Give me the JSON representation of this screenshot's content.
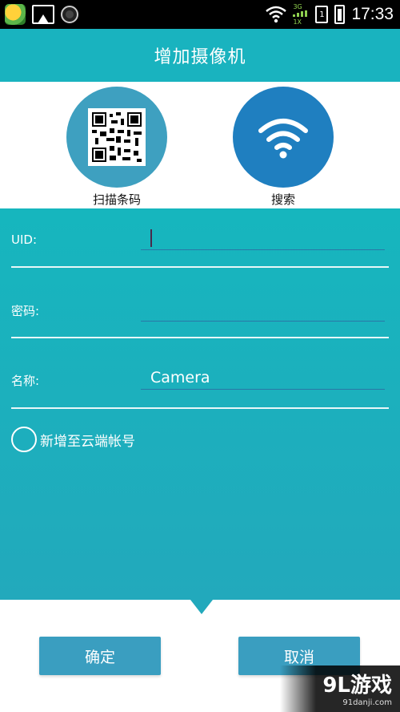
{
  "status_bar": {
    "time": "17:33",
    "signal_top": "3G",
    "signal_bottom": "1X",
    "sim": "1",
    "icons": [
      "game-app-icon",
      "gallery-icon",
      "camera-app-icon",
      "wifi-icon",
      "signal-icon",
      "sim-icon",
      "battery-icon"
    ]
  },
  "header": {
    "title": "增加摄像机"
  },
  "actions": {
    "scan": {
      "label": "扫描条码",
      "icon": "qr-code-icon"
    },
    "search": {
      "label": "搜索",
      "icon": "wifi-icon"
    }
  },
  "form": {
    "uid": {
      "label": "UID:",
      "value": ""
    },
    "password": {
      "label": "密码:",
      "value": ""
    },
    "name": {
      "label": "名称:",
      "value": "Camera"
    },
    "cloud_account": {
      "label": "新增至云端帐号",
      "checked": false
    }
  },
  "buttons": {
    "ok": "确定",
    "cancel": "取消"
  },
  "watermark": {
    "brand": "9L游戏",
    "site": "91danji.com"
  },
  "colors": {
    "header": "#19b3bf",
    "form_bg": "#16b6be",
    "button": "#3a9ec0",
    "qr_circle": "#3ea0c0",
    "wifi_circle": "#1f7fc0"
  }
}
